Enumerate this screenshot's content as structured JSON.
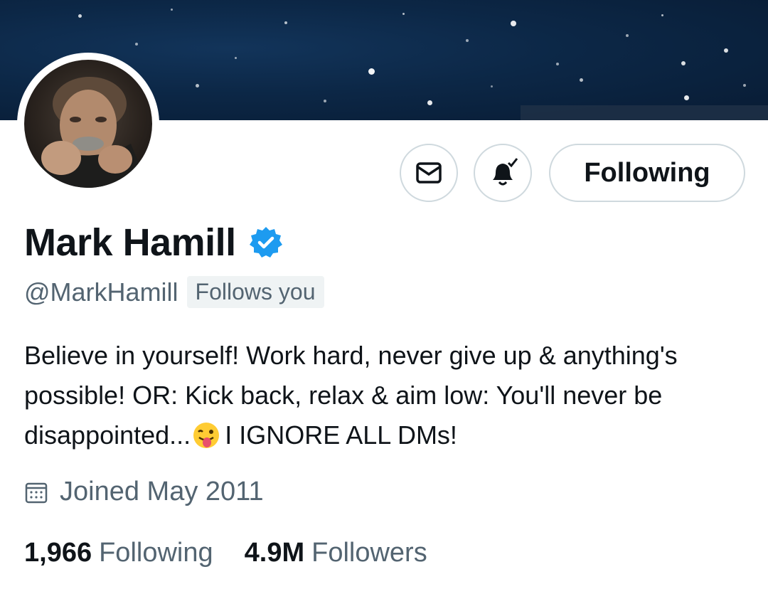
{
  "profile": {
    "display_name": "Mark Hamill",
    "handle": "@MarkHamill",
    "follows_you_badge": "Follows you",
    "bio_text": "Believe in yourself! Work hard, never give up & anything's possible! OR: Kick back, relax & aim low: You'll never be disappointed...",
    "bio_emoji": "winking-face-with-tongue",
    "bio_tail": "I IGNORE ALL DMs!",
    "joined": "Joined May 2011",
    "following_count": "1,966",
    "following_label": "Following",
    "followers_count": "4.9M",
    "followers_label": "Followers",
    "verified": true
  },
  "actions": {
    "message_icon": "envelope-icon",
    "notify_icon": "bell-check-icon",
    "follow_label": "Following"
  },
  "colors": {
    "text_primary": "#0f1419",
    "text_secondary": "#536471",
    "border": "#cfd9de",
    "verified_blue": "#1d9bf0",
    "banner": "#0c2746"
  }
}
